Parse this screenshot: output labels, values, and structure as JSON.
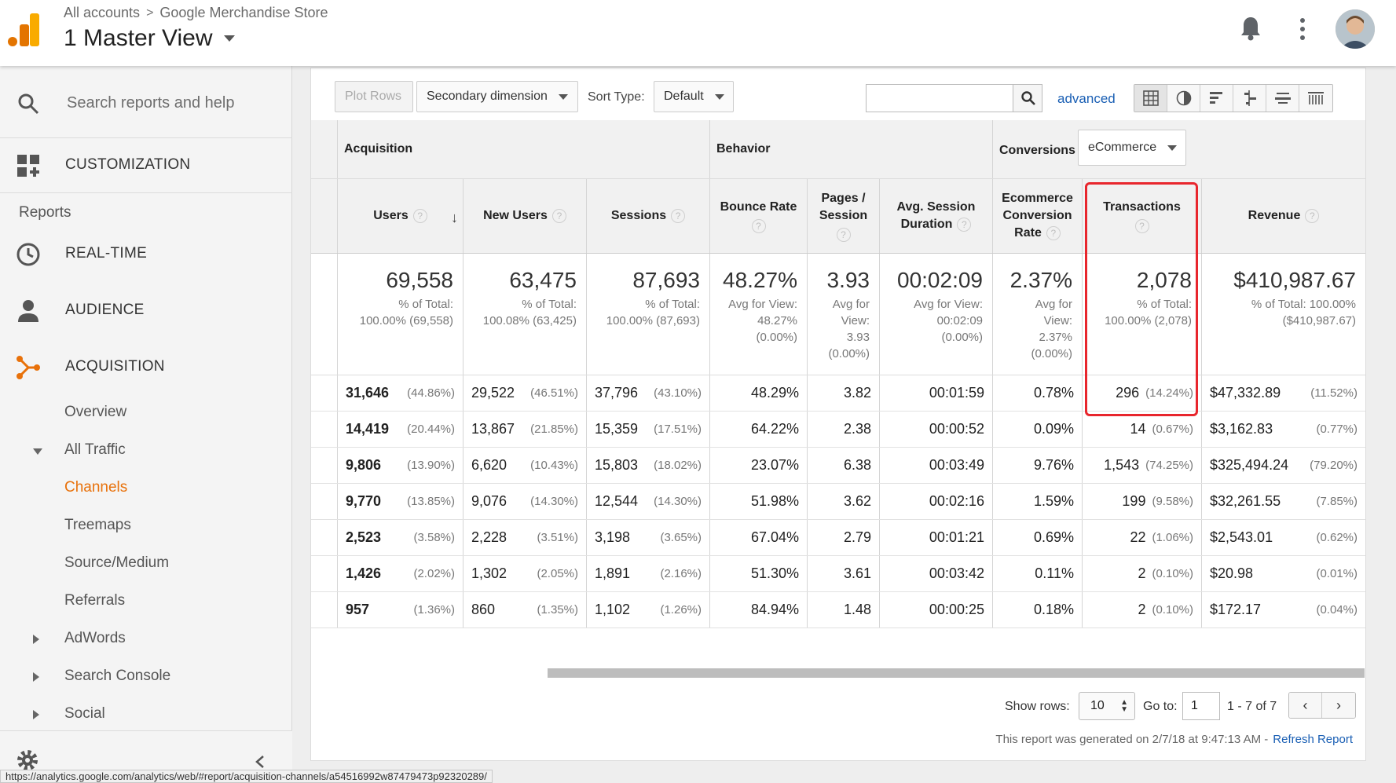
{
  "header": {
    "breadcrumb_root": "All accounts",
    "breadcrumb_sep": ">",
    "breadcrumb_property": "Google Merchandise Store",
    "view_title": "1 Master View"
  },
  "sidebar": {
    "search_placeholder": "Search reports and help",
    "customization": "CUSTOMIZATION",
    "reports_label": "Reports",
    "main_items": [
      {
        "label": "REAL-TIME",
        "icon": "clock-icon"
      },
      {
        "label": "AUDIENCE",
        "icon": "person-icon"
      },
      {
        "label": "ACQUISITION",
        "icon": "acquisition-icon"
      }
    ],
    "sub_items": [
      {
        "label": "Overview"
      },
      {
        "label": "All Traffic"
      },
      {
        "label": "Channels"
      },
      {
        "label": "Treemaps"
      },
      {
        "label": "Source/Medium"
      },
      {
        "label": "Referrals"
      },
      {
        "label": "AdWords"
      },
      {
        "label": "Search Console"
      },
      {
        "label": "Social"
      }
    ],
    "accent_color": "#e8710a"
  },
  "status_url": "https://analytics.google.com/analytics/web/#report/acquisition-channels/a54516992w87479473p92320289/",
  "toolbar": {
    "plot_rows": "Plot Rows",
    "secondary_dimension": "Secondary dimension",
    "sort_type_label": "Sort Type:",
    "sort_type_value": "Default",
    "advanced": "advanced"
  },
  "table": {
    "groups": {
      "acquisition": "Acquisition",
      "behavior": "Behavior",
      "conversions": "Conversions",
      "conversions_select": "eCommerce"
    },
    "headers": {
      "users": "Users",
      "new_users": "New Users",
      "sessions": "Sessions",
      "bounce_rate": "Bounce Rate",
      "pages_session_1": "Pages /",
      "pages_session_2": "Session",
      "avg_dur_1": "Avg. Session",
      "avg_dur_2": "Duration",
      "ecr_1": "Ecommerce",
      "ecr_2": "Conversion",
      "ecr_3": "Rate",
      "transactions": "Transactions",
      "revenue": "Revenue",
      "help": "?",
      "sort_arrow": "↓"
    },
    "totals": {
      "users": {
        "big": "69,558",
        "l1": "% of Total:",
        "l2": "100.00% (69,558)"
      },
      "new_users": {
        "big": "63,475",
        "l1": "% of Total:",
        "l2": "100.08% (63,425)"
      },
      "sessions": {
        "big": "87,693",
        "l1": "% of Total:",
        "l2": "100.00% (87,693)"
      },
      "bounce_rate": {
        "big": "48.27%",
        "l1": "Avg for View:",
        "l2": "48.27%",
        "l3": "(0.00%)"
      },
      "pages": {
        "big": "3.93",
        "l1": "Avg for",
        "l2": "View:",
        "l3": "3.93",
        "l4": "(0.00%)"
      },
      "duration": {
        "big": "00:02:09",
        "l1": "Avg for View:",
        "l2": "00:02:09",
        "l3": "(0.00%)"
      },
      "ecr": {
        "big": "2.37%",
        "l1": "Avg for",
        "l2": "View:",
        "l3": "2.37%",
        "l4": "(0.00%)"
      },
      "transactions": {
        "big": "2,078",
        "l1": "% of Total:",
        "l2": "100.00% (2,078)"
      },
      "revenue": {
        "big": "$410,987.67",
        "l1": "% of Total: 100.00%",
        "l2": "($410,987.67)"
      }
    },
    "rows": [
      {
        "users": "31,646",
        "users_pct": "(44.86%)",
        "new_users": "29,522",
        "new_users_pct": "(46.51%)",
        "sessions": "37,796",
        "sessions_pct": "(43.10%)",
        "bounce": "48.29%",
        "pages": "3.82",
        "duration": "00:01:59",
        "ecr": "0.78%",
        "transactions": "296",
        "transactions_pct": "(14.24%)",
        "revenue": "$47,332.89",
        "revenue_pct": "(11.52%)"
      },
      {
        "users": "14,419",
        "users_pct": "(20.44%)",
        "new_users": "13,867",
        "new_users_pct": "(21.85%)",
        "sessions": "15,359",
        "sessions_pct": "(17.51%)",
        "bounce": "64.22%",
        "pages": "2.38",
        "duration": "00:00:52",
        "ecr": "0.09%",
        "transactions": "14",
        "transactions_pct": "(0.67%)",
        "revenue": "$3,162.83",
        "revenue_pct": "(0.77%)"
      },
      {
        "users": "9,806",
        "users_pct": "(13.90%)",
        "new_users": "6,620",
        "new_users_pct": "(10.43%)",
        "sessions": "15,803",
        "sessions_pct": "(18.02%)",
        "bounce": "23.07%",
        "pages": "6.38",
        "duration": "00:03:49",
        "ecr": "9.76%",
        "transactions": "1,543",
        "transactions_pct": "(74.25%)",
        "revenue": "$325,494.24",
        "revenue_pct": "(79.20%)"
      },
      {
        "users": "9,770",
        "users_pct": "(13.85%)",
        "new_users": "9,076",
        "new_users_pct": "(14.30%)",
        "sessions": "12,544",
        "sessions_pct": "(14.30%)",
        "bounce": "51.98%",
        "pages": "3.62",
        "duration": "00:02:16",
        "ecr": "1.59%",
        "transactions": "199",
        "transactions_pct": "(9.58%)",
        "revenue": "$32,261.55",
        "revenue_pct": "(7.85%)"
      },
      {
        "users": "2,523",
        "users_pct": "(3.58%)",
        "new_users": "2,228",
        "new_users_pct": "(3.51%)",
        "sessions": "3,198",
        "sessions_pct": "(3.65%)",
        "bounce": "67.04%",
        "pages": "2.79",
        "duration": "00:01:21",
        "ecr": "0.69%",
        "transactions": "22",
        "transactions_pct": "(1.06%)",
        "revenue": "$2,543.01",
        "revenue_pct": "(0.62%)"
      },
      {
        "users": "1,426",
        "users_pct": "(2.02%)",
        "new_users": "1,302",
        "new_users_pct": "(2.05%)",
        "sessions": "1,891",
        "sessions_pct": "(2.16%)",
        "bounce": "51.30%",
        "pages": "3.61",
        "duration": "00:03:42",
        "ecr": "0.11%",
        "transactions": "2",
        "transactions_pct": "(0.10%)",
        "revenue": "$20.98",
        "revenue_pct": "(0.01%)"
      },
      {
        "users": "957",
        "users_pct": "(1.36%)",
        "new_users": "860",
        "new_users_pct": "(1.35%)",
        "sessions": "1,102",
        "sessions_pct": "(1.26%)",
        "bounce": "84.94%",
        "pages": "1.48",
        "duration": "00:00:25",
        "ecr": "0.18%",
        "transactions": "2",
        "transactions_pct": "(0.10%)",
        "revenue": "$172.17",
        "revenue_pct": "(0.04%)"
      }
    ],
    "highlight_color": "#e8262d"
  },
  "pagination": {
    "show_rows_label": "Show rows:",
    "show_rows_value": "10",
    "goto_label": "Go to:",
    "goto_value": "1",
    "range": "1 - 7 of 7",
    "prev": "‹",
    "next": "›"
  },
  "footer": {
    "generated": "This report was generated on 2/7/18 at 9:47:13 AM -",
    "refresh": "Refresh Report"
  }
}
